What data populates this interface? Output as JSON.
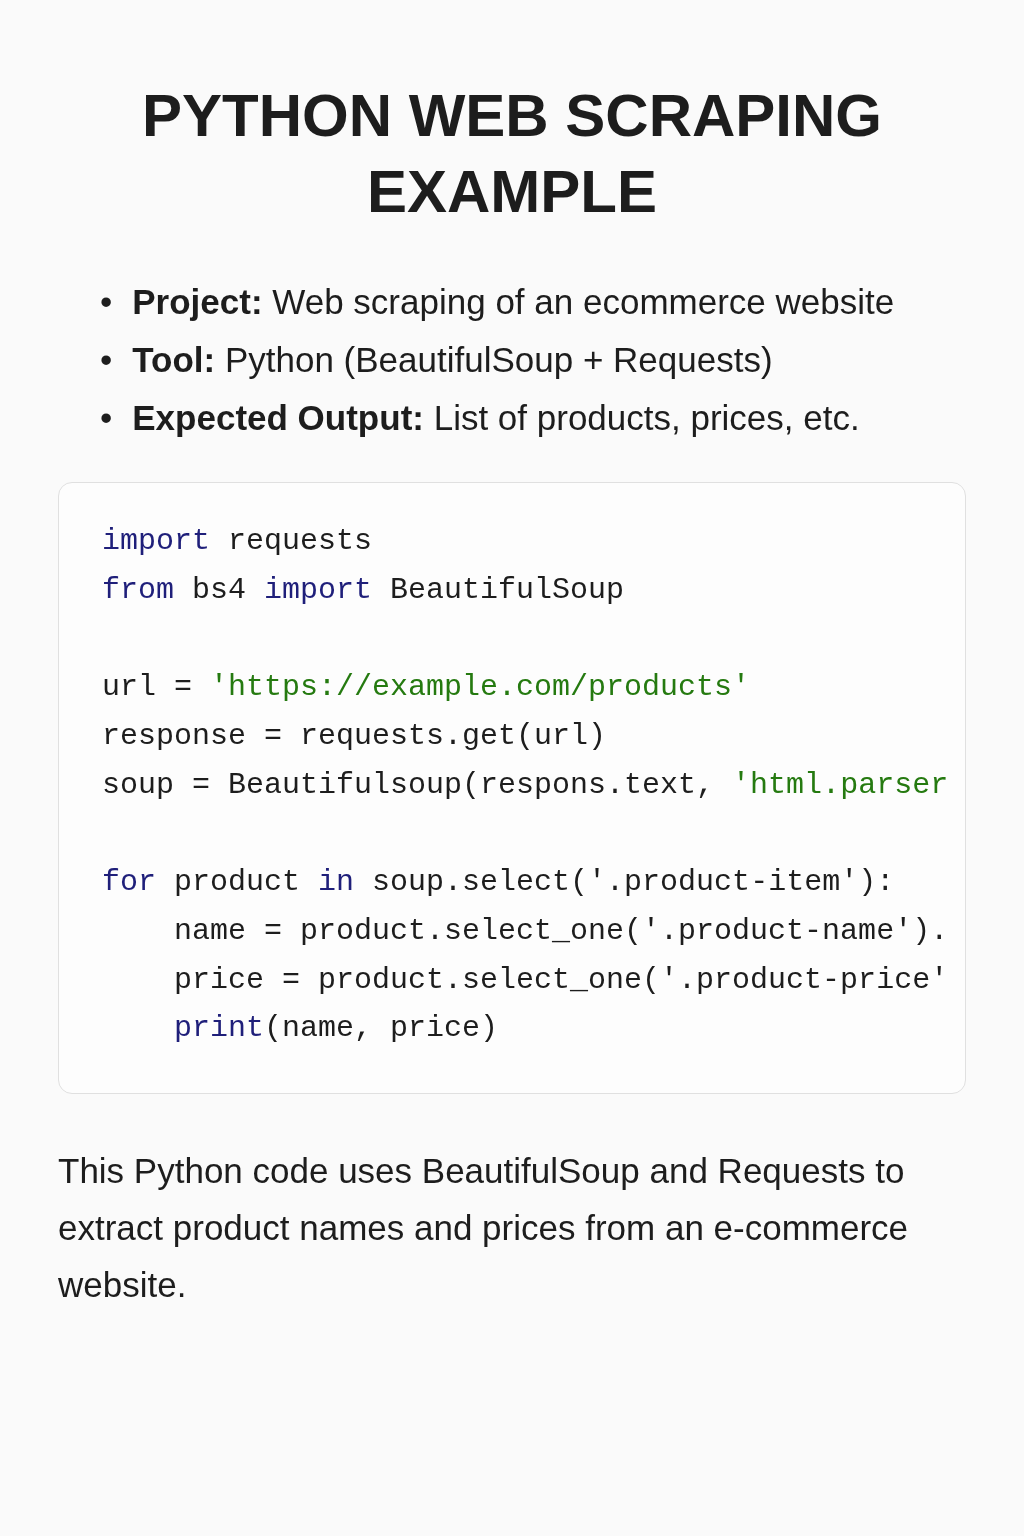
{
  "title": "PYTHON WEB SCRAPING EXAMPLE",
  "bullets": [
    {
      "marker": "•",
      "text": "**Project:** Web scraping of an ecommerce website"
    },
    {
      "marker": "•",
      "text": "**Tool:** Python (BeautifulSoup + Requests)"
    },
    {
      "marker": "•",
      "text": "**Expected Output:** List of products, prices, etc."
    }
  ],
  "code_blocks": [
    [
      [
        {
          "kind": "keyword",
          "text": "import"
        },
        {
          "kind": "plain",
          "text": " requests"
        }
      ],
      [
        {
          "kind": "keyword",
          "text": "from"
        },
        {
          "kind": "plain",
          "text": " bs4 "
        },
        {
          "kind": "keyword",
          "text": "import"
        },
        {
          "kind": "plain",
          "text": " BeautifulSoup"
        }
      ]
    ],
    [
      [
        {
          "kind": "plain",
          "text": "url = "
        },
        {
          "kind": "string",
          "text": "'https://example.com/products'"
        }
      ],
      [
        {
          "kind": "plain",
          "text": "response = requests.get(url)"
        }
      ],
      [
        {
          "kind": "plain",
          "text": "soup = Beautifulsoup(respons.text, "
        },
        {
          "kind": "string",
          "text": "'html.parser"
        }
      ]
    ],
    [
      [
        {
          "kind": "keyword",
          "text": "for"
        },
        {
          "kind": "plain",
          "text": " product "
        },
        {
          "kind": "keyword",
          "text": "in"
        },
        {
          "kind": "plain",
          "text": " soup.select('.product-item'):"
        }
      ],
      [
        {
          "kind": "plain",
          "text": "    name = product.select_one('.product-name')."
        }
      ],
      [
        {
          "kind": "plain",
          "text": "    price = product.select_one('.product-price'"
        }
      ],
      [
        {
          "kind": "keyword",
          "text": "    print"
        },
        {
          "kind": "plain",
          "text": "(name, price)"
        }
      ]
    ]
  ],
  "description": "This Python code uses BeautifulSoup and Requests to extract product names and prices from an e-commerce website."
}
